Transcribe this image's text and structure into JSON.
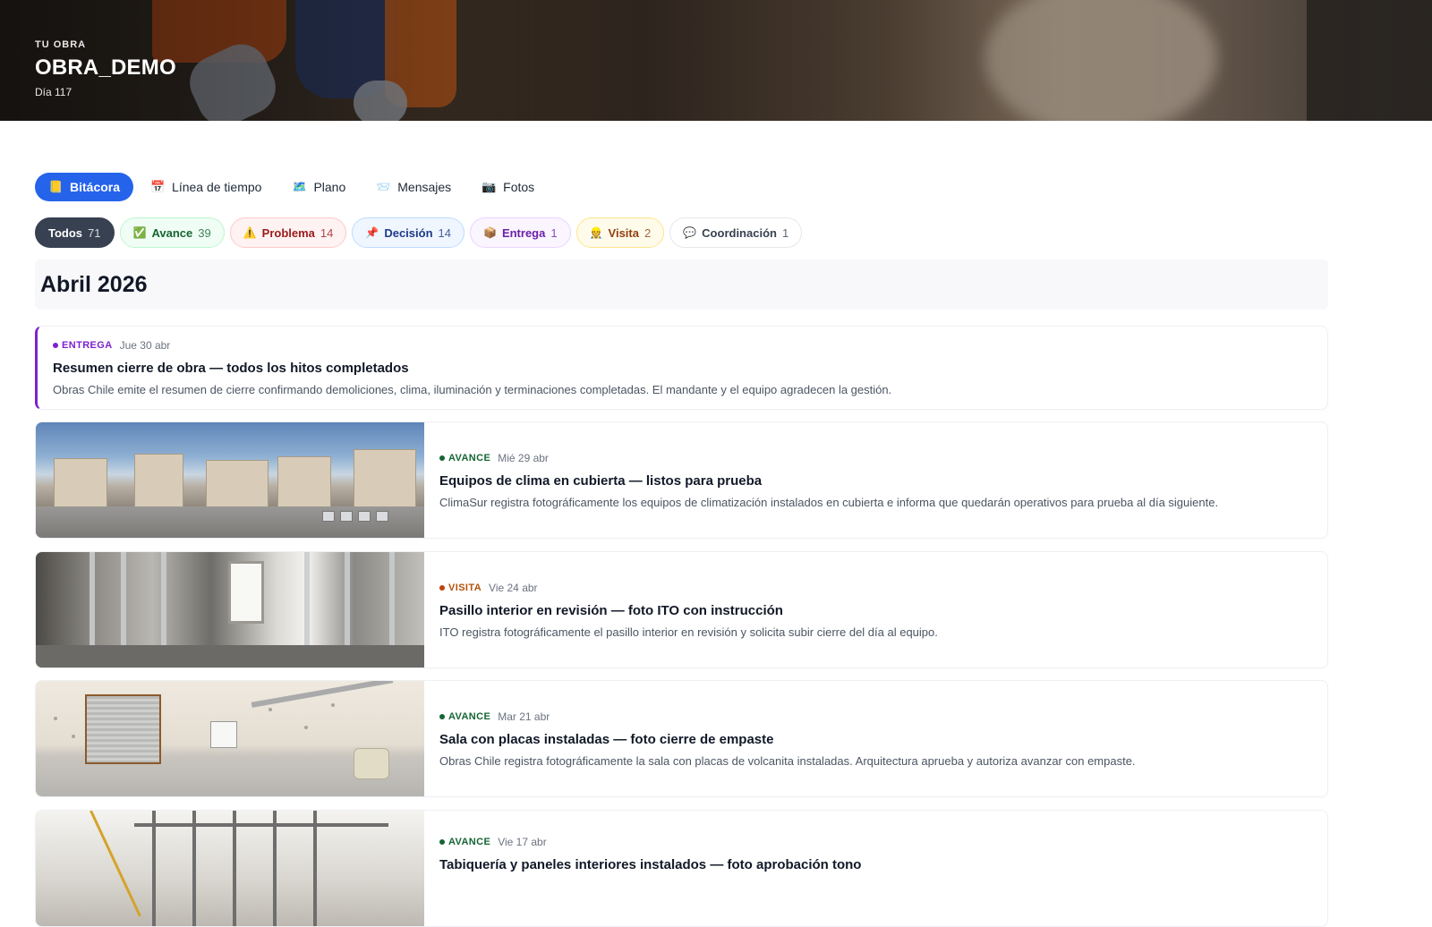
{
  "hero": {
    "kicker": "TU OBRA",
    "title": "OBRA_DEMO",
    "day": "Día 117"
  },
  "tabs": [
    {
      "icon": "📒",
      "label": "Bitácora",
      "active": true
    },
    {
      "icon": "📅",
      "label": "Línea de tiempo",
      "active": false
    },
    {
      "icon": "🗺️",
      "label": "Plano",
      "active": false
    },
    {
      "icon": "📨",
      "label": "Mensajes",
      "active": false
    },
    {
      "icon": "📷",
      "label": "Fotos",
      "active": false
    }
  ],
  "filters": [
    {
      "icon": "",
      "label": "Todos",
      "count": "71"
    },
    {
      "icon": "✅",
      "label": "Avance",
      "count": "39"
    },
    {
      "icon": "⚠️",
      "label": "Problema",
      "count": "14"
    },
    {
      "icon": "📌",
      "label": "Decisión",
      "count": "14"
    },
    {
      "icon": "📦",
      "label": "Entrega",
      "count": "1"
    },
    {
      "icon": "👷",
      "label": "Visita",
      "count": "2"
    },
    {
      "icon": "💬",
      "label": "Coordinación",
      "count": "1"
    }
  ],
  "month": "Abril 2026",
  "entries": [
    {
      "kind": "ENTREGA",
      "date": "Jue 30 abr",
      "title": "Resumen cierre de obra — todos los hitos completados",
      "desc": "Obras Chile emite el resumen de cierre confirmando demoliciones, clima, iluminación y terminaciones completadas. El mandante y el equipo agradecen la gestión."
    },
    {
      "kind": "AVANCE",
      "date": "Mié 29 abr",
      "title": "Equipos de clima en cubierta — listos para prueba",
      "desc": "ClimaSur registra fotográficamente los equipos de climatización instalados en cubierta e informa que quedarán operativos para prueba al día siguiente."
    },
    {
      "kind": "VISITA",
      "date": "Vie 24 abr",
      "title": "Pasillo interior en revisión — foto ITO con instrucción",
      "desc": "ITO registra fotográficamente el pasillo interior en revisión y solicita subir cierre del día al equipo."
    },
    {
      "kind": "AVANCE",
      "date": "Mar 21 abr",
      "title": "Sala con placas instaladas — foto cierre de empaste",
      "desc": "Obras Chile registra fotográficamente la sala con placas de volcanita instaladas. Arquitectura aprueba y autoriza avanzar con empaste."
    },
    {
      "kind": "AVANCE",
      "date": "Vie 17 abr",
      "title": "Tabiquería y paneles interiores instalados — foto aprobación tono",
      "desc": ""
    }
  ]
}
